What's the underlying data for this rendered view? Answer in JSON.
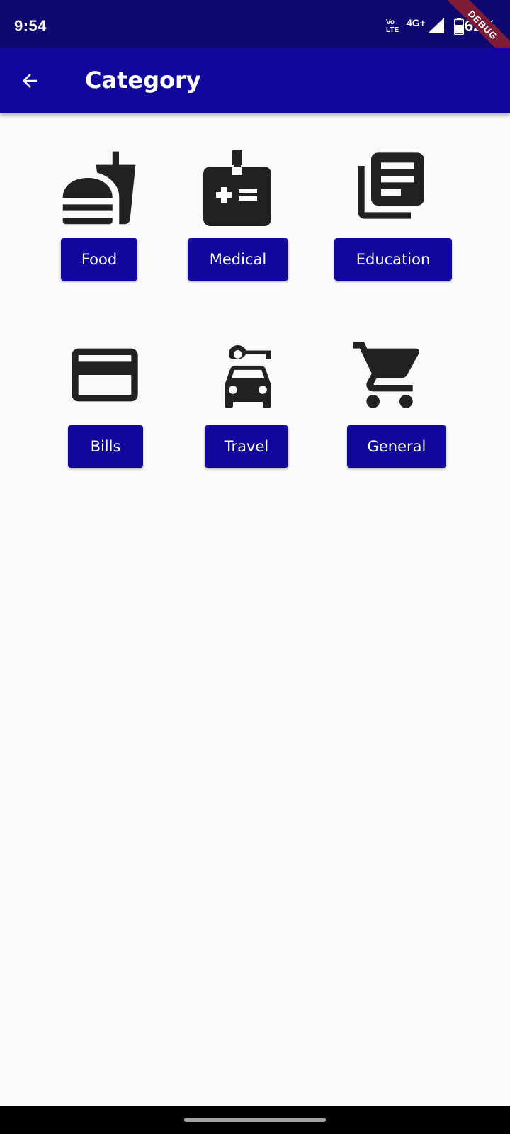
{
  "status_bar": {
    "time": "9:54",
    "volte": "Vo",
    "lte": "LTE",
    "network": "4G+",
    "battery": "62%",
    "debug_banner": "DEBUG",
    "icons": [
      "signal-icon",
      "battery-icon"
    ]
  },
  "app_bar": {
    "title": "Category",
    "back_icon": "arrow-back-icon",
    "background": "#12079c"
  },
  "categories": [
    {
      "label": "Food",
      "icon": "fastfood-icon"
    },
    {
      "label": "Medical",
      "icon": "medical-badge-icon"
    },
    {
      "label": "Education",
      "icon": "library-books-icon"
    },
    {
      "label": "Bills",
      "icon": "credit-card-icon"
    },
    {
      "label": "Travel",
      "icon": "car-rental-icon"
    },
    {
      "label": "General",
      "icon": "shopping-cart-icon"
    }
  ],
  "colors": {
    "accent": "#12079c",
    "status_bar": "#0f086f",
    "icon": "#212121",
    "background": "#fafafa"
  }
}
